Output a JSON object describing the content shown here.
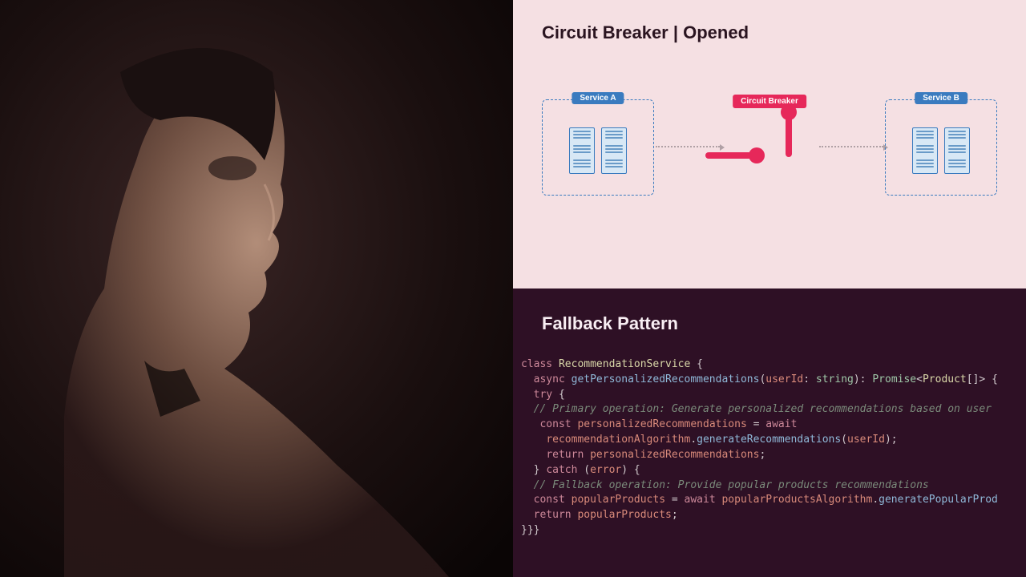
{
  "diagram": {
    "title": "Circuit Breaker | Opened",
    "serviceA": "Service A",
    "serviceB": "Service B",
    "breaker": "Circuit Breaker"
  },
  "code": {
    "title": "Fallback Pattern",
    "tokens": {
      "class": "class",
      "className": "RecommendationService",
      "async": "async",
      "method": "getPersonalizedRecommendations",
      "paramName": "userId",
      "paramType": "string",
      "returnType": "Promise",
      "returnGeneric": "Product",
      "try": "try",
      "comment1": "// Primary operation: Generate personalized recommendations based on user data",
      "const": "const",
      "var1": "personalizedRecommendations",
      "await": "await",
      "obj1": "recommendationAlgorithm",
      "call1": "generateRecommendations",
      "return": "return",
      "catch": "catch",
      "error": "error",
      "comment2": "// Fallback operation: Provide popular products recommendations",
      "var2": "popularProducts",
      "obj2": "popularProductsAlgorithm",
      "call2": "generatePopularProducts",
      "close": "}}}"
    }
  }
}
